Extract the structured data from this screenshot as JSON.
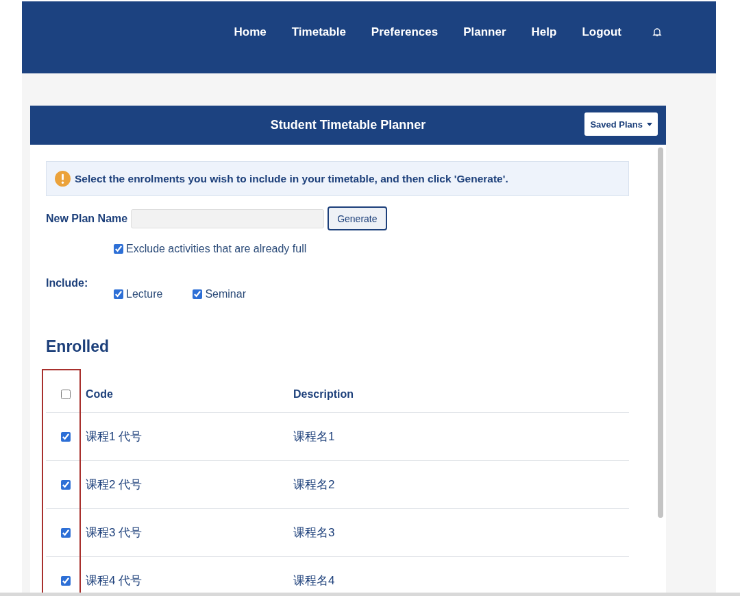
{
  "nav": {
    "items": [
      "Home",
      "Timetable",
      "Preferences",
      "Planner",
      "Help",
      "Logout"
    ]
  },
  "panel": {
    "title": "Student Timetable Planner",
    "saved_plans": "Saved Plans"
  },
  "notice": "Select the enrolments you wish to include in your timetable, and then click 'Generate'.",
  "plan_name": {
    "label": "New Plan Name",
    "button": "Generate"
  },
  "exclude_full": {
    "label": "Exclude activities that are already full",
    "checked": true
  },
  "include": {
    "label": "Include:",
    "options": [
      {
        "label": "Lecture",
        "checked": true
      },
      {
        "label": "Seminar",
        "checked": true
      }
    ]
  },
  "enrolled": {
    "title": "Enrolled",
    "select_all_checked": false,
    "columns": [
      "Code",
      "Description"
    ],
    "rows": [
      {
        "code": "课程1 代号",
        "description": "课程名1",
        "checked": true
      },
      {
        "code": "课程2 代号",
        "description": "课程名2",
        "checked": true
      },
      {
        "code": "课程3 代号",
        "description": "课程名3",
        "checked": true
      },
      {
        "code": "课程4 代号",
        "description": "课程名4",
        "checked": true
      }
    ]
  }
}
